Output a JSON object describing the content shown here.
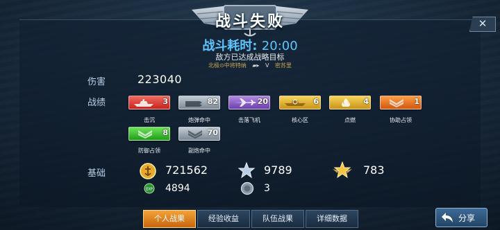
{
  "header": {
    "title": "战斗失败",
    "close_label": "✕"
  },
  "summary": {
    "duration_label": "战斗耗时:",
    "duration_value": "20:00",
    "result_text": "敌方已达成战略目标",
    "player_left": "北极⊙中将特纳",
    "vs": "V",
    "player_right": "密苏里"
  },
  "damage": {
    "label": "伤害",
    "value": "223040"
  },
  "achievements": {
    "label": "战绩",
    "items": [
      {
        "name": "击沉",
        "count": "3",
        "color": "red",
        "icon": "ship-icon"
      },
      {
        "name": "炮弹命中",
        "count": "82",
        "color": "gray",
        "icon": "shell-icon"
      },
      {
        "name": "击落飞机",
        "count": "20",
        "color": "purple",
        "icon": "plane-icon"
      },
      {
        "name": "核心区",
        "count": "6",
        "color": "gold",
        "icon": "core-icon"
      },
      {
        "name": "点燃",
        "count": "4",
        "color": "gold",
        "icon": "fire-icon"
      },
      {
        "name": "协助占领",
        "count": "1",
        "color": "orange",
        "icon": "chevron-icon"
      },
      {
        "name": "防御占领",
        "count": "8",
        "color": "green",
        "icon": "chevron-icon"
      },
      {
        "name": "副炮命中",
        "count": "70",
        "color": "gray",
        "icon": "secondary-gun-icon"
      }
    ]
  },
  "basic": {
    "label": "基础",
    "silver": "721562",
    "crew_xp": "9789",
    "captain_xp": "783",
    "exp": "4894",
    "medals": "3"
  },
  "tabs": [
    {
      "label": "个人战果",
      "active": true
    },
    {
      "label": "经验收益",
      "active": false
    },
    {
      "label": "队伍战果",
      "active": false
    },
    {
      "label": "详细数据",
      "active": false
    }
  ],
  "share_label": "分享",
  "colors": {
    "accent_blue": "#5ec6ff",
    "active_tab": "#e48a26"
  }
}
